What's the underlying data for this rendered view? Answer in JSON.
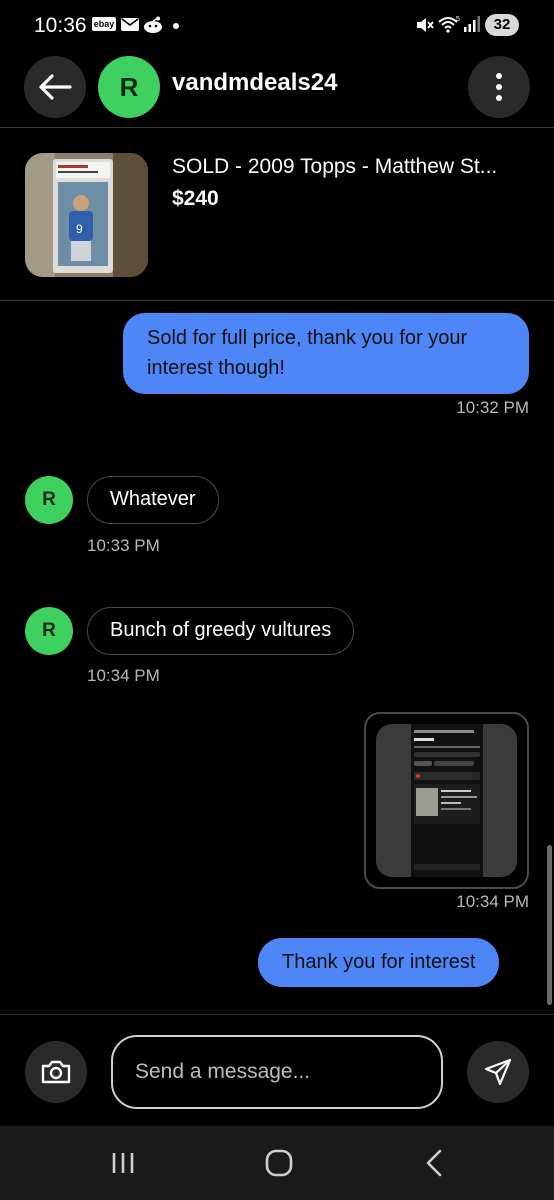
{
  "status_bar": {
    "time": "10:36",
    "ebay_badge": "ebay",
    "battery": "32",
    "icons": [
      "ebay-icon",
      "mail-icon",
      "reddit-icon",
      "notification-dot-icon",
      "mute-icon",
      "wifi-icon",
      "signal-icon",
      "battery-icon"
    ]
  },
  "header": {
    "avatar_initial": "R",
    "username": "vandmdeals24",
    "icons": [
      "back-arrow-icon",
      "more-vertical-icon"
    ]
  },
  "listing": {
    "title": "SOLD - 2009 Topps - Matthew St...",
    "price": "$240"
  },
  "messages": [
    {
      "direction": "outgoing",
      "type": "text",
      "text": "Sold for full price, thank you for your interest though!",
      "time": "10:32 PM"
    },
    {
      "direction": "incoming",
      "type": "text",
      "avatar_initial": "R",
      "text": "Whatever",
      "time": "10:33 PM"
    },
    {
      "direction": "incoming",
      "type": "text",
      "avatar_initial": "R",
      "text": "Bunch of greedy vultures",
      "time": "10:34 PM"
    },
    {
      "direction": "outgoing",
      "type": "image",
      "time": "10:34 PM"
    },
    {
      "direction": "outgoing",
      "type": "text",
      "text": "Thank you for interest",
      "time": ""
    }
  ],
  "compose": {
    "placeholder": "Send a message...",
    "value": "",
    "icons": [
      "camera-icon",
      "send-icon"
    ]
  },
  "nav_bar": {
    "icons": [
      "recents-icon",
      "home-icon",
      "back-icon"
    ]
  },
  "colors": {
    "background": "#000000",
    "outgoing_bubble": "#4f86f7",
    "avatar": "#3fd160",
    "timestamp": "#b8b8b8",
    "border": "#4a4a4a"
  }
}
